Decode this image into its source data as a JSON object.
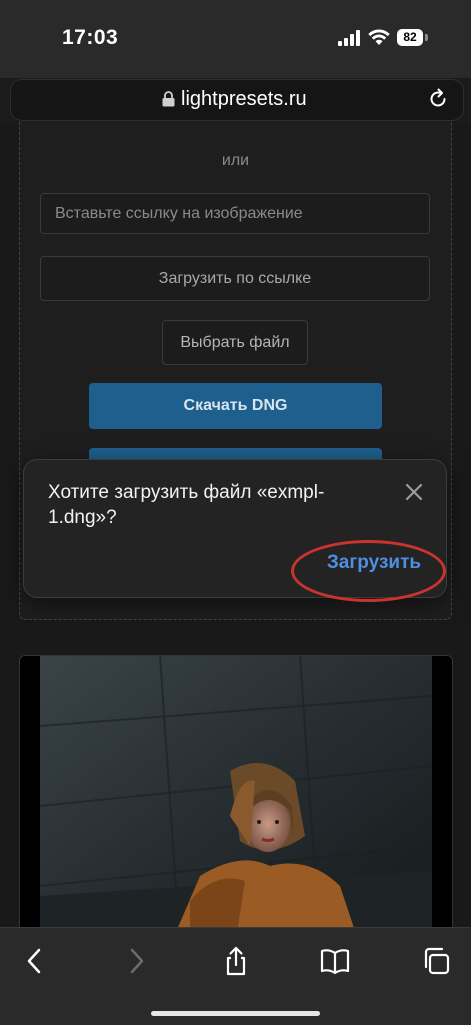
{
  "status_bar": {
    "time": "17:03",
    "battery": "82",
    "icons": [
      "signal-icon",
      "wifi-icon",
      "battery-icon"
    ]
  },
  "browser": {
    "url": "lightpresets.ru",
    "icons": [
      "lock-icon",
      "reload-icon"
    ]
  },
  "upload": {
    "or_text": "или",
    "url_input_placeholder": "Вставьте ссылку на изображение",
    "load_by_url_label": "Загрузить по ссылке",
    "choose_file_label": "Выбрать файл",
    "download_dng_label": "Скачать DNG"
  },
  "download_prompt": {
    "message": "Хотите загрузить файл «exmpl-1.dng»?",
    "download_label": "Загрузить",
    "icons": [
      "close-icon"
    ]
  },
  "toolbar": {
    "icons": [
      "back-icon",
      "forward-icon",
      "share-icon",
      "bookmarks-icon",
      "tabs-icon"
    ]
  },
  "colors": {
    "accent_blue": "#1e5f8e",
    "link_blue": "#4e8fe0",
    "highlight_red": "#c9342c"
  }
}
